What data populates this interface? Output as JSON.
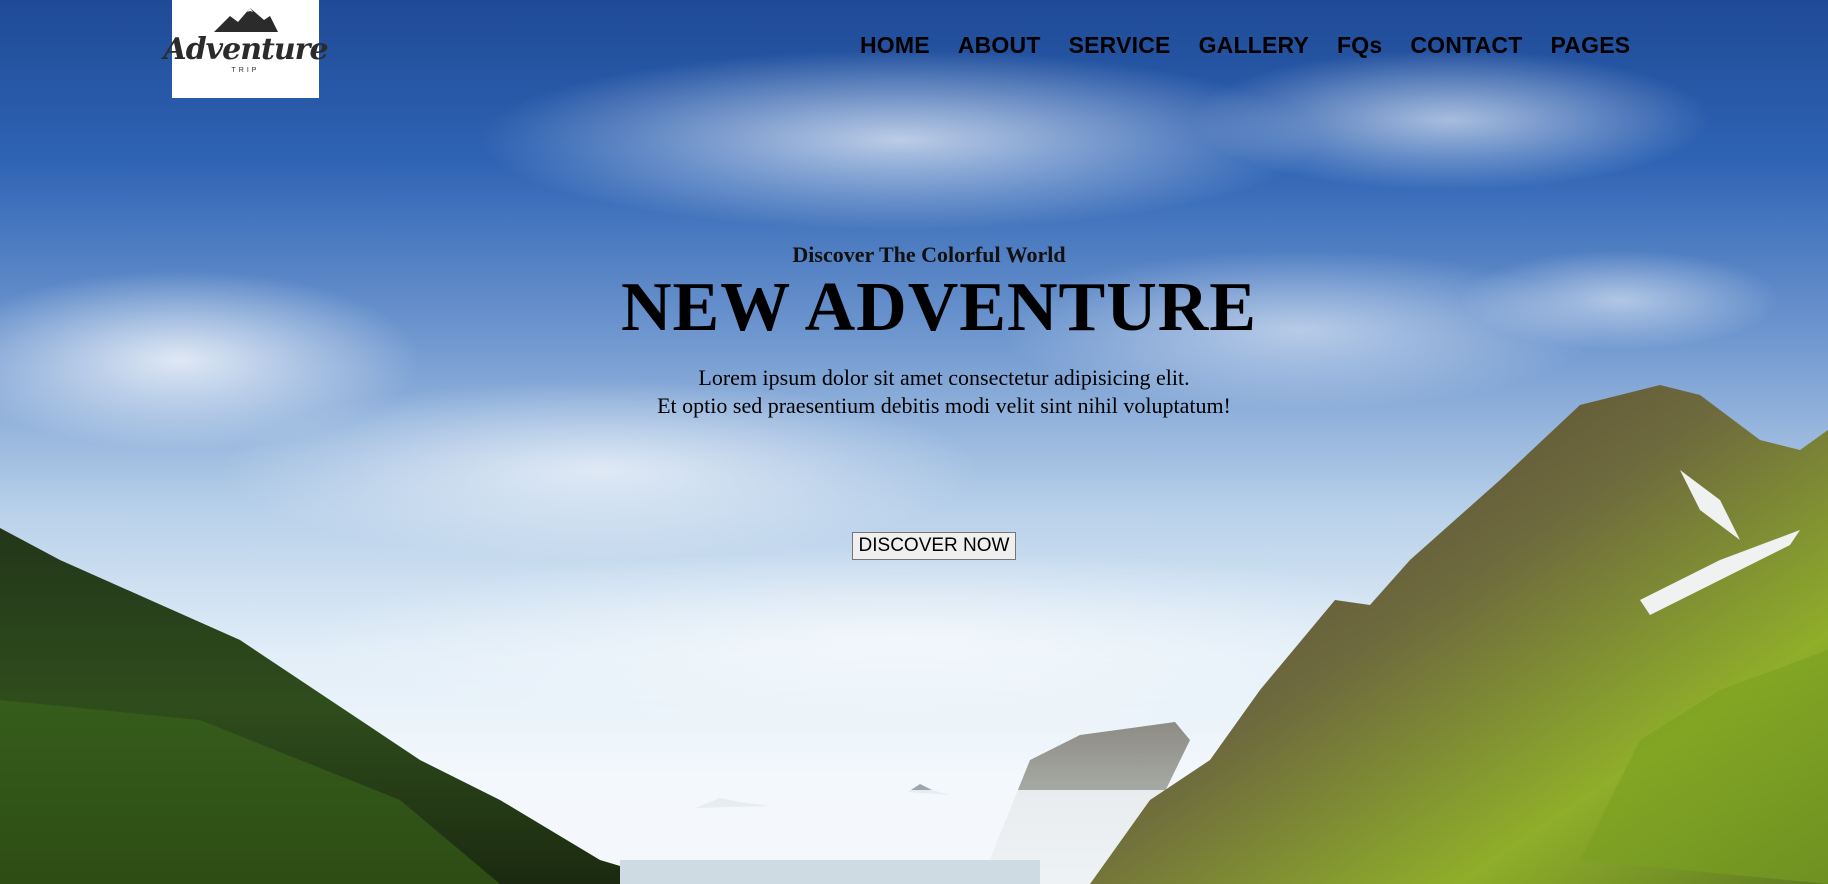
{
  "logo": {
    "script": "Adventure",
    "sub": "TRIP"
  },
  "nav": {
    "items": [
      {
        "label": "HOME"
      },
      {
        "label": "ABOUT"
      },
      {
        "label": "SERVICE"
      },
      {
        "label": "GALLERY"
      },
      {
        "label": "FQs"
      },
      {
        "label": "CONTACT"
      },
      {
        "label": "PAGES"
      }
    ]
  },
  "hero": {
    "kicker": "Discover The Colorful World",
    "headline": "NEW ADVENTURE",
    "desc_line1": "Lorem ipsum dolor sit amet consectetur adipisicing elit.",
    "desc_line2": "Et optio sed praesentium debitis modi velit sint nihil voluptatum!",
    "cta_label": "DISCOVER NOW"
  },
  "colors": {
    "sky_top": "#1f4a96",
    "sky_bottom": "#eaf3fb",
    "mountain_green": "#6a8f1c",
    "text": "#000000"
  }
}
